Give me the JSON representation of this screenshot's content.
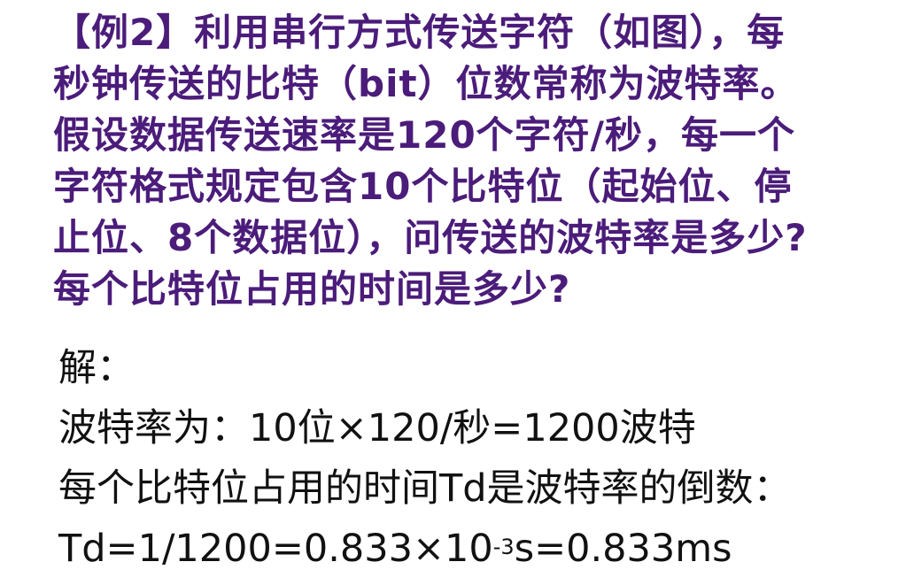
{
  "problem": {
    "lines": [
      "【例2】利用串行方式传送字符（如图），每",
      "秒钟传送的比特（bit）位数常称为波特率。",
      "假设数据传送速率是120个字符/秒，每一个",
      "字符格式规定包含10个比特位（起始位、停",
      "止位、8个数据位），问传送的波特率是多少?",
      "每个比特位占用的时间是多少?"
    ]
  },
  "solution": {
    "heading": "解：",
    "baud_rate_line": "波特率为：10位×120/秒=1200波特",
    "bit_time_line": "每个比特位占用的时间Td是波特率的倒数：",
    "formula_prefix": "Td=1/1200=0.833×10",
    "formula_exponent": "-3",
    "formula_suffix": "s=0.833ms"
  },
  "colors": {
    "problem_text": "#4b1c7a",
    "solution_text": "#111111",
    "background": "#ffffff"
  }
}
